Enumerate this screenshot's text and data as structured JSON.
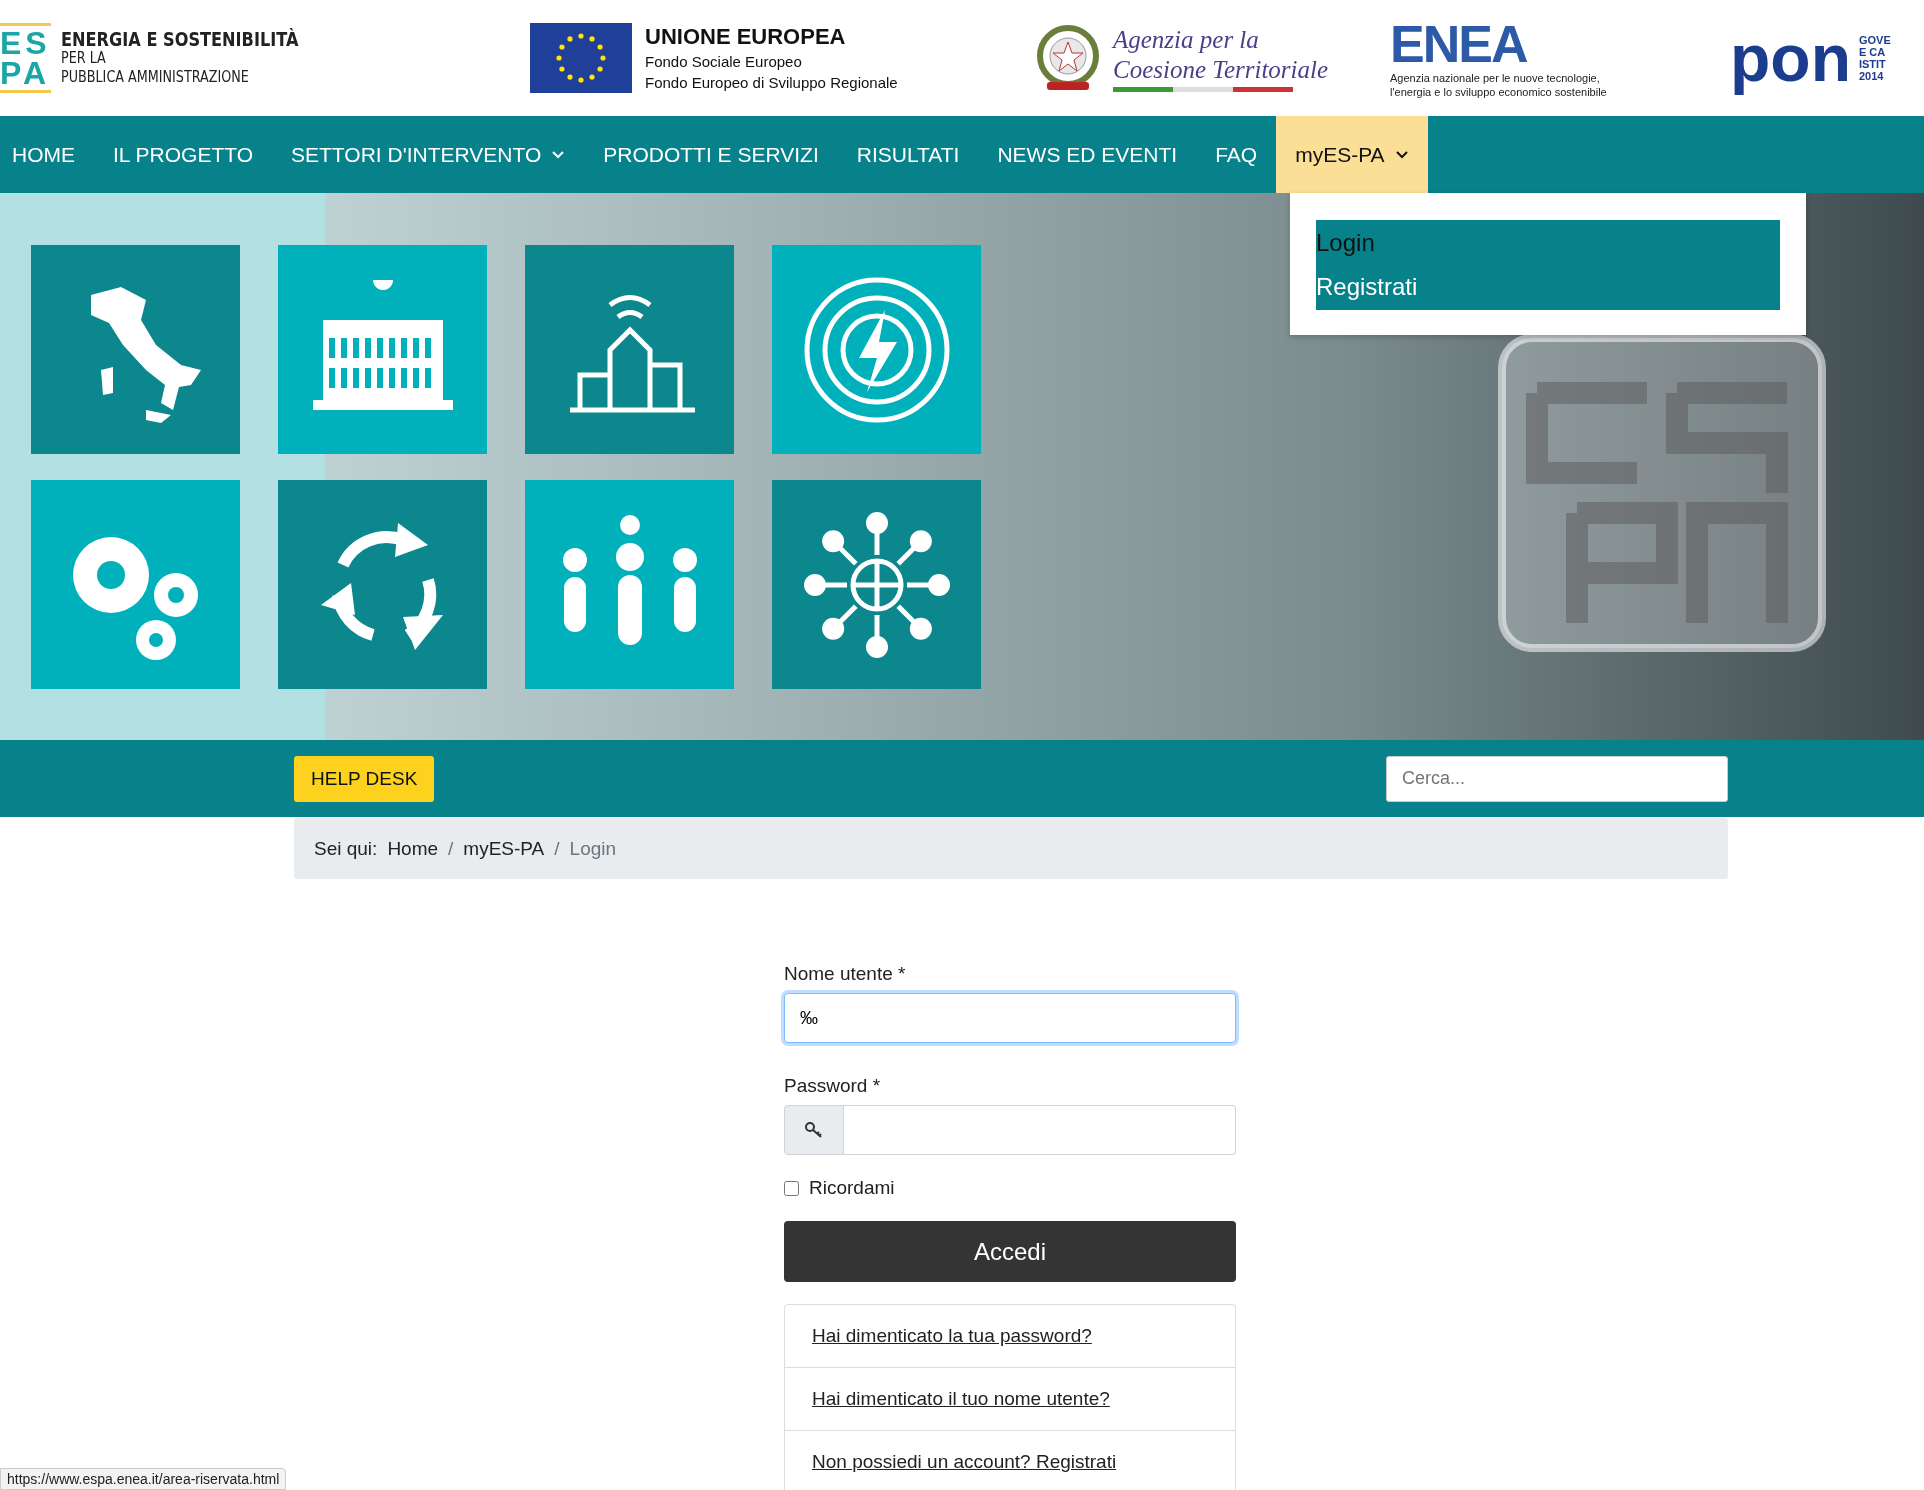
{
  "header": {
    "espa_logo": {
      "mark_top": "ES",
      "mark_bottom": "PA",
      "lines": [
        "ENERGIA E SOSTENIBILITÀ",
        "PER LA",
        "PUBBLICA AMMINISTRAZIONE"
      ]
    },
    "eu_logo": {
      "title": "UNIONE EUROPEA",
      "lines": [
        "Fondo Sociale Europeo",
        "Fondo Europeo di Sviluppo Regionale"
      ]
    },
    "agency_logo": {
      "lines": [
        "Agenzia per la",
        "Coesione Territoriale"
      ]
    },
    "enea_logo": {
      "name": "ENEA",
      "lines": [
        "Agenzia nazionale per le nuove tecnologie,",
        "l'energia e lo sviluppo economico sostenibile"
      ]
    },
    "pon_logo": {
      "name": "pon",
      "lines": [
        "GOVE",
        "E CA",
        "ISTIT",
        "2014"
      ]
    }
  },
  "nav": [
    {
      "label": "HOME",
      "dropdown": false,
      "selected": false
    },
    {
      "label": "IL PROGETTO",
      "dropdown": false,
      "selected": false
    },
    {
      "label": "SETTORI D'INTERVENTO",
      "dropdown": true,
      "selected": false
    },
    {
      "label": "PRODOTTI E SERVIZI",
      "dropdown": false,
      "selected": false
    },
    {
      "label": "RISULTATI",
      "dropdown": false,
      "selected": false
    },
    {
      "label": "NEWS ED EVENTI",
      "dropdown": false,
      "selected": false
    },
    {
      "label": "FAQ",
      "dropdown": false,
      "selected": false
    },
    {
      "label": "myES-PA",
      "dropdown": true,
      "selected": true
    }
  ],
  "dropdown_menu": [
    {
      "label": "Login",
      "selected": true
    },
    {
      "label": "Registrati",
      "selected": false
    }
  ],
  "tiles": [
    {
      "kind": "italy",
      "color": "#0b878d"
    },
    {
      "kind": "building",
      "color": "#00b1bb"
    },
    {
      "kind": "city",
      "color": "#0b878d"
    },
    {
      "kind": "energy",
      "color": "#00b1bb"
    },
    {
      "kind": "gears",
      "color": "#00b1bb"
    },
    {
      "kind": "cycle",
      "color": "#0b878d"
    },
    {
      "kind": "people",
      "color": "#00b1bb"
    },
    {
      "kind": "network",
      "color": "#0b878d"
    }
  ],
  "toolbar": {
    "help_button": "HELP DESK",
    "search": {
      "placeholder": "Cerca..."
    }
  },
  "breadcrumb": {
    "prefix": "Sei qui:",
    "separator": "/",
    "items": [
      "Home",
      "myES-PA",
      "Login"
    ]
  },
  "login_form": {
    "username": {
      "label": "Nome utente *",
      "value": "‰"
    },
    "password": {
      "label": "Password *"
    },
    "remember": {
      "label": "Ricordami",
      "checked": false
    },
    "submit": "Accedi",
    "links": [
      "Hai dimenticato la tua password?",
      "Hai dimenticato il tuo nome utente?",
      "Non possiedi un account? Registrati"
    ]
  },
  "status_url": "https://www.espa.enea.it/area-riservata.html"
}
